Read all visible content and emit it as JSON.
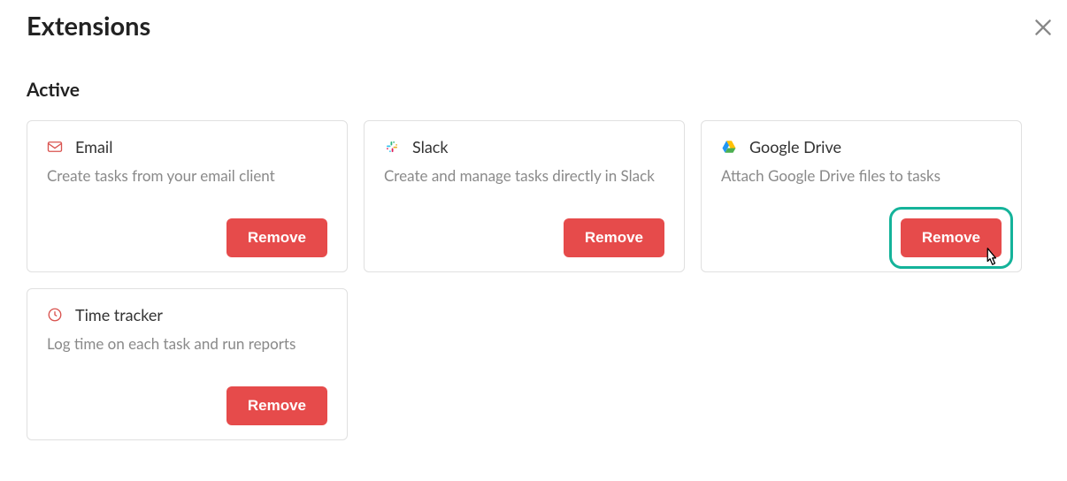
{
  "page_title": "Extensions",
  "section_title": "Active",
  "remove_label": "Remove",
  "cards": [
    {
      "title": "Email",
      "desc": "Create tasks from your email client",
      "icon": "email-icon"
    },
    {
      "title": "Slack",
      "desc": "Create and manage tasks directly in Slack",
      "icon": "slack-icon"
    },
    {
      "title": "Google Drive",
      "desc": "Attach Google Drive files to tasks",
      "icon": "google-drive-icon",
      "highlighted": true
    },
    {
      "title": "Time tracker",
      "desc": "Log time on each task and run reports",
      "icon": "clock-icon"
    }
  ]
}
